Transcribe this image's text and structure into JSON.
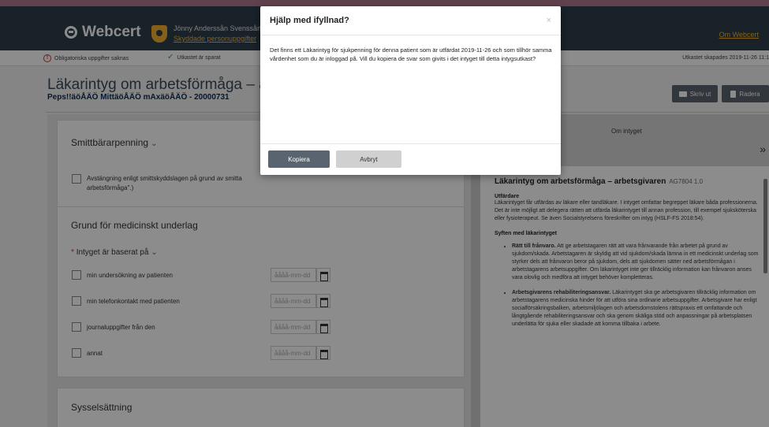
{
  "header": {
    "logo_text": "Webcert",
    "user_name": "Jönny Anderssån Svenssån",
    "user_link": "Skyddade personuppgifter",
    "about_link": "Om Webcert"
  },
  "statusbar": {
    "missing_fields": "Obligatoriska uppgifter saknas",
    "saved": "Utkastet är sparat",
    "created": "Utkastet skapades 2019-11-26 11:1"
  },
  "document": {
    "title": "Läkarintyg om arbetsförmåga – arbets",
    "patient": "Peps!!äöÅÄÖ MittäöÅÄÖ mAxäöÅÄÖ - 20000731",
    "print_label": "Skriv ut",
    "delete_label": "Radera"
  },
  "form": {
    "sections": {
      "smitt": {
        "title": "Smittbärarpenning",
        "checkbox_line1": "Avstängning enligt smittskyddslagen på grund av smitta",
        "checkbox_line2": "arbetsförmåga\".)"
      },
      "grund": {
        "title": "Grund för medicinskt underlag",
        "question": "Intyget är baserat på",
        "options": [
          {
            "label": "min undersökning av patienten",
            "placeholder": "åååå-mm-dd"
          },
          {
            "label": "min telefonkontakt med patienten",
            "placeholder": "åååå-mm-dd"
          },
          {
            "label": "journaluppgifter från den",
            "placeholder": "åååå-mm-dd"
          },
          {
            "label": "annat",
            "placeholder": "åååå-mm-dd"
          }
        ]
      },
      "syssel": {
        "title": "Sysselsättning"
      }
    }
  },
  "info_panel": {
    "tab_label": "Om intyget",
    "heading": "Läkarintyg om arbetsförmåga – arbetsgivaren",
    "version": "AG7804 1.0",
    "utfardare_title": "Utfärdare",
    "utfardare_text": "Läkarintyget får utfärdas av läkare eller tandläkare. I intyget omfattar begreppet läkare båda professionerna. Det är inte möjligt att delegera rätten att utfärda läkarintyget till annan profession, till exempel sjuksköterska eller fysioterapeut. Se även Socialstyrelsens föreskrifter om intyg (HSLF-FS 2018:54).",
    "syfte_title": "Syften med läkarintyget",
    "bullet1_bold": "Rätt till frånvaro.",
    "bullet1_text": "Att ge arbetstagaren rätt att vara frånvarande från arbetet på grund av sjukdom/skada. Arbetstagaren är skyldig att vid sjukdom/skada lämna in ett medicinskt underlag som styrker dels att frånvaron beror på sjukdom, dels att sjukdomen sätter ned arbetsförmågan i arbetstagarens arbetsuppgifter. Om läkarintyget inte ger tillräcklig information kan frånvaron anses vara olovlig och medföra att intyget behöver kompletteras.",
    "bullet2_bold": "Arbetsgivarens rehabiliteringsansvar.",
    "bullet2_text": "Läkarintyget ska ge arbetsgivaren tillräcklig information om arbetstagarens medicinska hinder för att utföra sina ordinarie arbetsuppgifter. Arbetsgivare har enligt socialförsäkringsbalken, arbetsmiljölagen och arbetsdomstolens rättspraxis ett omfattande och långtgående rehabiliteringsansvar och ska genom skäliga stöd och anpassningar på arbetsplatsen underlätta för sjuka eller skadade att komma tillbaka i arbete."
  },
  "modal": {
    "title": "Hjälp med ifyllnad?",
    "close": "×",
    "body": "Det finns ett Läkarintyg för sjukpenning för denna patient som är utfärdat 2019-11-26 och som tillhör samma vårdenhet som du är inloggad på. Vill du kopiera de svar som givits i det intyget till detta intygsutkast?",
    "copy_label": "Kopiera",
    "cancel_label": "Avbryt"
  }
}
